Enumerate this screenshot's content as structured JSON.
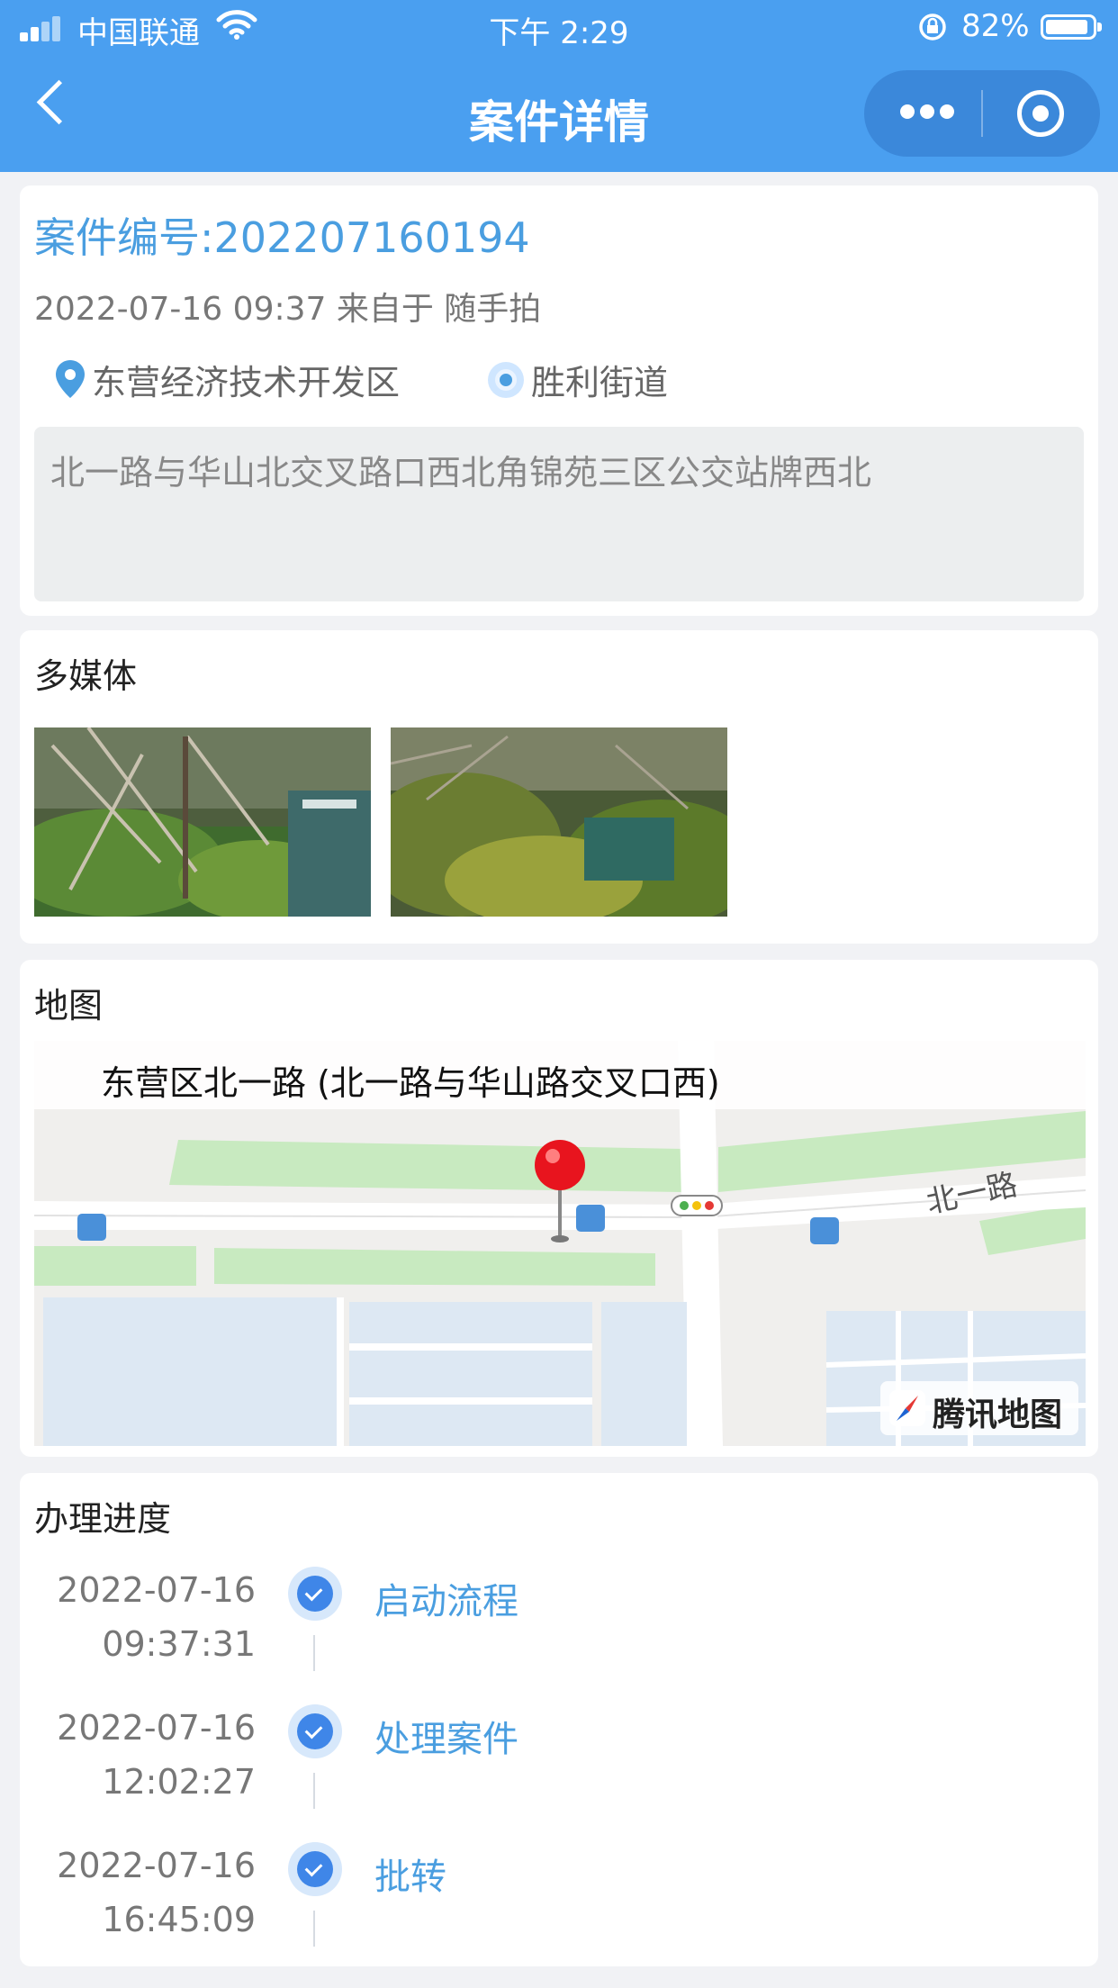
{
  "status_bar": {
    "carrier": "中国联通",
    "time": "下午 2:29",
    "battery": "82%"
  },
  "nav": {
    "title": "案件详情"
  },
  "case": {
    "number": "案件编号:202207160194",
    "meta": "2022-07-16 09:37 来自于 随手拍",
    "district": "东营经济技术开发区",
    "street": "胜利街道",
    "address": "北一路与华山北交叉路口西北角锦苑三区公交站牌西北"
  },
  "media": {
    "title": "多媒体",
    "images": [
      "photo-1",
      "photo-2"
    ]
  },
  "map": {
    "title": "地图",
    "callout": "东营区北一路 (北一路与华山路交叉口西)",
    "road_label": "北一路",
    "provider": "腾讯地图"
  },
  "progress": {
    "title": "办理进度",
    "steps": [
      {
        "date": "2022-07-16",
        "time": "09:37:31",
        "label": "启动流程"
      },
      {
        "date": "2022-07-16",
        "time": "12:02:27",
        "label": "处理案件"
      },
      {
        "date": "2022-07-16",
        "time": "16:45:09",
        "label": "批转"
      }
    ]
  },
  "colors": {
    "header_bg": "#4a9ff0",
    "accent": "#4a9ee0",
    "check": "#3f86e8"
  }
}
